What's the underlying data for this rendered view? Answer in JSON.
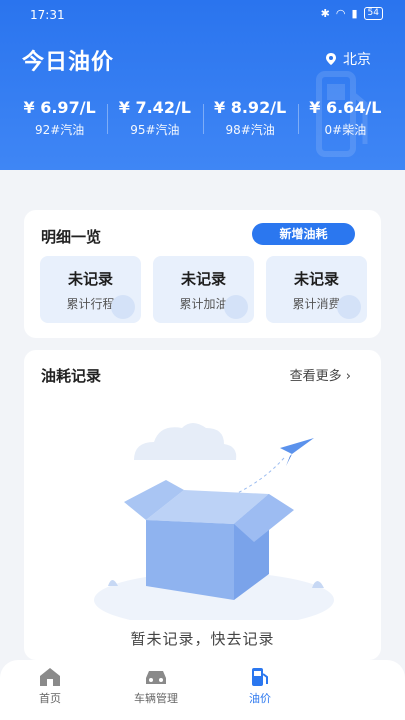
{
  "status_bar": {
    "time": "17:31",
    "battery": "54"
  },
  "header": {
    "title": "今日油价",
    "location": "北京",
    "prices": [
      {
        "value": "¥ 6.97/L",
        "label": "92#汽油"
      },
      {
        "value": "¥ 7.42/L",
        "label": "95#汽油"
      },
      {
        "value": "¥ 8.92/L",
        "label": "98#汽油"
      },
      {
        "value": "¥ 6.64/L",
        "label": "0#柴油"
      }
    ]
  },
  "details": {
    "title": "明细一览",
    "add_button": "新增油耗",
    "tiles": [
      {
        "value": "未记录",
        "label": "累计行程"
      },
      {
        "value": "未记录",
        "label": "累计加油"
      },
      {
        "value": "未记录",
        "label": "累计消费"
      }
    ]
  },
  "records": {
    "title": "油耗记录",
    "more": "查看更多",
    "empty_text": "暂未记录，快去记录"
  },
  "tabbar": {
    "tabs": [
      {
        "label": "首页",
        "icon": "home-icon"
      },
      {
        "label": "车辆管理",
        "icon": "car-icon"
      },
      {
        "label": "油价",
        "icon": "fuel-pump-icon"
      }
    ]
  },
  "colors": {
    "primary": "#2b77ef",
    "header_gradient_top": "#2a74ee",
    "tile_bg": "#e8f0fc"
  }
}
